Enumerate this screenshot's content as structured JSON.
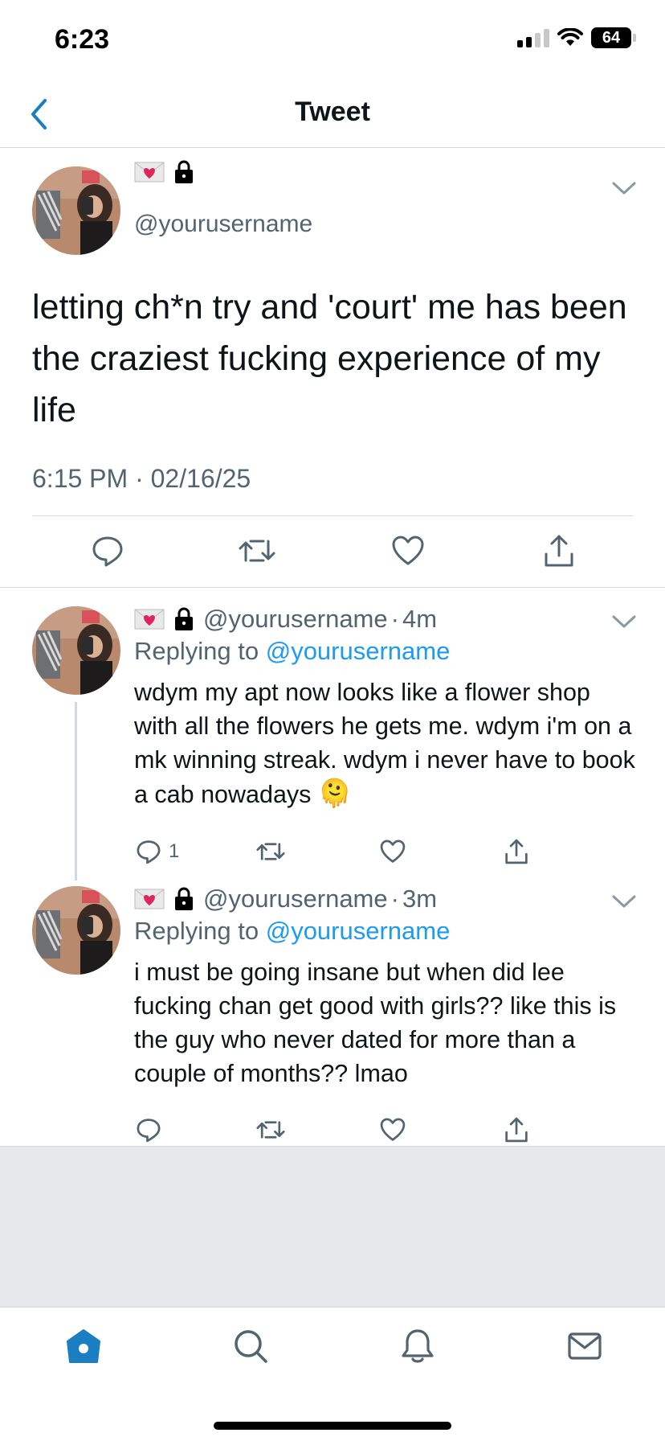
{
  "status_bar": {
    "time": "6:23",
    "battery": "64"
  },
  "header": {
    "title": "Tweet"
  },
  "main_tweet": {
    "handle": "@yourusername",
    "text": "letting ch*n try and 'court' me has been the craziest fucking experience of my life",
    "timestamp": "6:15 PM · 02/16/25"
  },
  "replies": [
    {
      "handle": "@yourusername",
      "time_sep": "·",
      "time": "4m",
      "replying_prefix": "Replying to",
      "replying_to": "@yourusername",
      "text": "wdym my apt now looks like a flower shop with all the flowers he gets me. wdym i'm on a mk winning streak. wdym i never have to book a cab nowadays",
      "emoji": "🫠",
      "reply_count": "1"
    },
    {
      "handle": "@yourusername",
      "time_sep": "·",
      "time": "3m",
      "replying_prefix": "Replying to",
      "replying_to": "@yourusername",
      "text": "i must be going insane but when did lee fucking chan get good with girls?? like this is the guy who never dated for more than a couple of months?? lmao",
      "emoji": "",
      "reply_count": ""
    }
  ],
  "colors": {
    "accent": "#1d9bf0",
    "nav_active": "#1a7ec2",
    "secondary_text": "#536471",
    "tray": "#e6e8ec"
  },
  "tab_bar": {
    "items": [
      "home-icon",
      "search-icon",
      "notifications-icon",
      "messages-icon"
    ]
  }
}
